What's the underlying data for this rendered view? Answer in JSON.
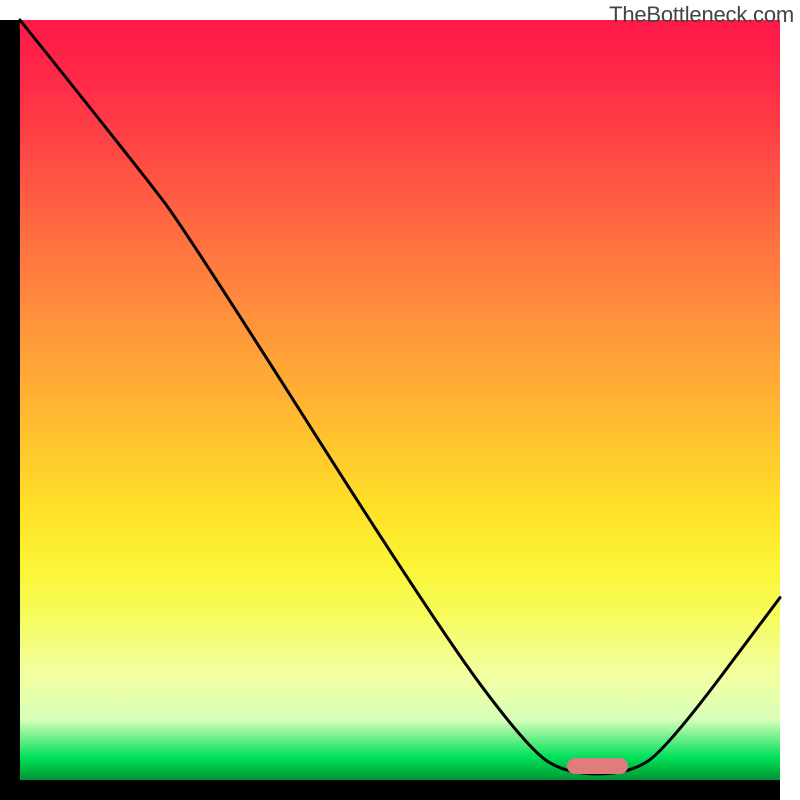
{
  "watermark": "TheBottleneck.com",
  "chart_data": {
    "type": "line",
    "title": "",
    "xlabel": "",
    "ylabel": "",
    "xlim": [
      0,
      100
    ],
    "ylim": [
      0,
      100
    ],
    "background_gradient": {
      "orientation": "vertical",
      "stops": [
        {
          "pos": 0,
          "color": "#ff1848"
        },
        {
          "pos": 8,
          "color": "#ff2a48"
        },
        {
          "pos": 18,
          "color": "#ff4a44"
        },
        {
          "pos": 30,
          "color": "#ff7340"
        },
        {
          "pos": 42,
          "color": "#ff9a3a"
        },
        {
          "pos": 54,
          "color": "#ffbf30"
        },
        {
          "pos": 64,
          "color": "#ffe028"
        },
        {
          "pos": 72,
          "color": "#fbf536"
        },
        {
          "pos": 78,
          "color": "#f6fb5a"
        },
        {
          "pos": 86,
          "color": "#f2ffa0"
        },
        {
          "pos": 92,
          "color": "#d9ffb8"
        },
        {
          "pos": 97,
          "color": "#00e05a"
        },
        {
          "pos": 98,
          "color": "#00c84a"
        },
        {
          "pos": 99,
          "color": "#00af40"
        },
        {
          "pos": 100,
          "color": "#009236"
        }
      ]
    },
    "series": [
      {
        "name": "bottleneck-curve",
        "color": "#000000",
        "points": [
          {
            "x": 0,
            "y": 100
          },
          {
            "x": 16,
            "y": 80
          },
          {
            "x": 22,
            "y": 72
          },
          {
            "x": 55,
            "y": 20
          },
          {
            "x": 67,
            "y": 4
          },
          {
            "x": 72,
            "y": 0.8
          },
          {
            "x": 80,
            "y": 0.8
          },
          {
            "x": 85,
            "y": 4
          },
          {
            "x": 100,
            "y": 24
          }
        ]
      }
    ],
    "marker": {
      "name": "optimal-range",
      "x_start": 72,
      "x_end": 80,
      "y": 1.8,
      "color": "#e07c7c"
    }
  }
}
